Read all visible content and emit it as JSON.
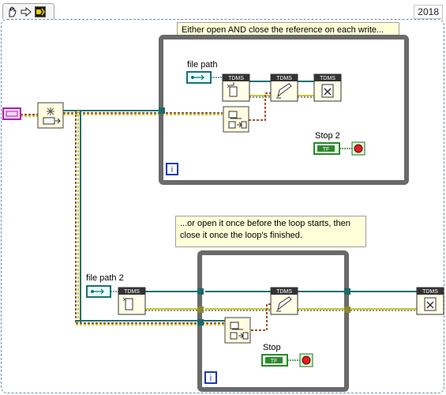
{
  "toolbar": {
    "icons": [
      "hand-grab-icon",
      "arrow-right-icon",
      "highlight-execution-icon"
    ]
  },
  "version": "2018",
  "comments": {
    "top": "Either open AND close the reference on each write...",
    "bottom": "...or open it once before the loop starts, then\nclose it once the loop's finished."
  },
  "controls": {
    "file_path_1": "file path",
    "file_path_2": "file path 2",
    "stop_1": "Stop 2",
    "stop_2": "Stop"
  },
  "tdms_labels": {
    "header": "TDMS",
    "bool": "TF"
  },
  "loop_index": "i",
  "colors": {
    "loop_border": "#6a6a6a",
    "wire_path": "#3b8a8a",
    "wire_error_a": "#c8c830",
    "wire_error_b": "#222222",
    "wire_refnum": "#1a7070",
    "wire_bool": "#2a8a2a",
    "wire_dynamic": "#a0522d",
    "tunnel_ref": "#1a6a6a",
    "tunnel_err": "#8a8a30",
    "stop_red": "#e02020",
    "iteration_blue": "#1a3ab0"
  }
}
